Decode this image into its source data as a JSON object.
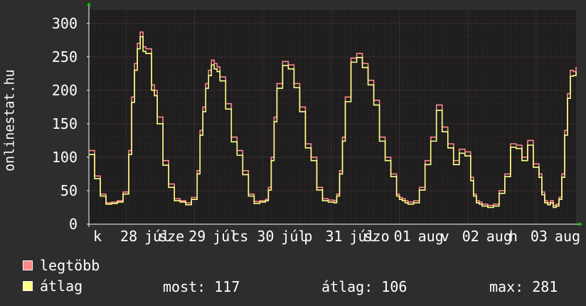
{
  "ylabel": "onlinestat.hu",
  "colors": {
    "background": "#2d2d2d",
    "plot_bg": "#1e1e1e",
    "grid_major": "#5a3a3a",
    "grid_minor": "#3e2a2a",
    "axis": "#ffffff",
    "tick_label": "#ffffff",
    "arrow": "#00cc00",
    "legtobb": "#ff8888",
    "atlag": "#ffff88"
  },
  "legend": [
    {
      "label": "legtöbb",
      "color": "#ff8888"
    },
    {
      "label": "átlag",
      "color": "#ffff88"
    }
  ],
  "stats": {
    "most": "most: 117",
    "atlag": "átlag: 106",
    "max": "max: 281"
  },
  "chart_data": {
    "type": "line",
    "ylabel": "onlinestat.hu",
    "ylim": [
      0,
      320
    ],
    "yticks": [
      0,
      50,
      100,
      150,
      200,
      250,
      300
    ],
    "xlim": [
      0,
      171
    ],
    "xtick_labels": [
      {
        "x": 3,
        "label": "k"
      },
      {
        "x": 14,
        "label": "28"
      },
      {
        "x": 24,
        "label": "júl"
      },
      {
        "x": 29,
        "label": "sze"
      },
      {
        "x": 38,
        "label": "29"
      },
      {
        "x": 48,
        "label": "júl"
      },
      {
        "x": 53,
        "label": "cs"
      },
      {
        "x": 62,
        "label": "30"
      },
      {
        "x": 72,
        "label": "júl"
      },
      {
        "x": 77,
        "label": "p"
      },
      {
        "x": 86,
        "label": "31"
      },
      {
        "x": 96,
        "label": "júl"
      },
      {
        "x": 101,
        "label": "szo"
      },
      {
        "x": 110,
        "label": "01"
      },
      {
        "x": 120,
        "label": "aug"
      },
      {
        "x": 125,
        "label": "v"
      },
      {
        "x": 134,
        "label": "02"
      },
      {
        "x": 144,
        "label": "aug"
      },
      {
        "x": 149,
        "label": "h"
      },
      {
        "x": 158,
        "label": "03"
      },
      {
        "x": 168,
        "label": "aug"
      }
    ],
    "grid": true,
    "legend_position": "bottom-left",
    "series": [
      {
        "name": "legtöbb",
        "color": "#ff8888",
        "x": [
          0,
          2,
          4,
          6,
          8,
          10,
          12,
          14,
          15,
          16,
          17,
          18,
          19,
          20,
          22,
          23,
          24,
          26,
          28,
          30,
          32,
          34,
          36,
          38,
          39,
          40,
          41,
          42,
          43,
          44,
          45,
          46,
          48,
          50,
          52,
          54,
          56,
          58,
          60,
          62,
          63,
          64,
          65,
          66,
          68,
          70,
          72,
          74,
          76,
          78,
          80,
          82,
          84,
          86,
          87,
          88,
          89,
          90,
          92,
          94,
          96,
          98,
          100,
          102,
          104,
          106,
          108,
          109,
          110,
          111,
          112,
          114,
          116,
          118,
          120,
          122,
          124,
          126,
          128,
          130,
          132,
          134,
          135,
          136,
          137,
          138,
          140,
          142,
          144,
          146,
          148,
          150,
          152,
          154,
          156,
          158,
          159,
          160,
          161,
          162,
          163,
          164,
          165,
          166,
          167,
          168,
          169,
          170,
          171
        ],
        "values": [
          110,
          72,
          45,
          32,
          33,
          35,
          48,
          110,
          190,
          240,
          270,
          287,
          265,
          262,
          208,
          200,
          160,
          95,
          60,
          38,
          35,
          32,
          40,
          80,
          140,
          175,
          210,
          230,
          245,
          240,
          235,
          220,
          180,
          130,
          110,
          80,
          45,
          34,
          35,
          37,
          55,
          100,
          160,
          210,
          243,
          238,
          210,
          175,
          120,
          100,
          55,
          38,
          36,
          35,
          45,
          80,
          130,
          190,
          248,
          255,
          240,
          215,
          185,
          130,
          100,
          75,
          45,
          40,
          38,
          35,
          33,
          35,
          55,
          95,
          130,
          178,
          145,
          120,
          95,
          112,
          108,
          70,
          45,
          35,
          33,
          30,
          28,
          30,
          50,
          75,
          120,
          118,
          100,
          125,
          90,
          75,
          48,
          35,
          32,
          35,
          28,
          30,
          40,
          75,
          140,
          195,
          230,
          228,
          235
        ]
      },
      {
        "name": "átlag",
        "color": "#ffff88",
        "x": [
          0,
          2,
          4,
          6,
          8,
          10,
          12,
          14,
          15,
          16,
          17,
          18,
          19,
          20,
          22,
          23,
          24,
          26,
          28,
          30,
          32,
          34,
          36,
          38,
          39,
          40,
          41,
          42,
          43,
          44,
          45,
          46,
          48,
          50,
          52,
          54,
          56,
          58,
          60,
          62,
          63,
          64,
          65,
          66,
          68,
          70,
          72,
          74,
          76,
          78,
          80,
          82,
          84,
          86,
          87,
          88,
          89,
          90,
          92,
          94,
          96,
          98,
          100,
          102,
          104,
          106,
          108,
          109,
          110,
          111,
          112,
          114,
          116,
          118,
          120,
          122,
          124,
          126,
          128,
          130,
          132,
          134,
          135,
          136,
          137,
          138,
          140,
          142,
          144,
          146,
          148,
          150,
          152,
          154,
          156,
          158,
          159,
          160,
          161,
          162,
          163,
          164,
          165,
          166,
          167,
          168,
          169,
          170,
          171
        ],
        "values": [
          104,
          68,
          42,
          30,
          31,
          33,
          45,
          104,
          182,
          230,
          262,
          280,
          258,
          255,
          200,
          192,
          150,
          88,
          55,
          35,
          33,
          29,
          37,
          75,
          133,
          168,
          203,
          222,
          238,
          232,
          228,
          214,
          172,
          123,
          103,
          74,
          42,
          31,
          33,
          35,
          51,
          95,
          153,
          203,
          237,
          232,
          204,
          168,
          114,
          95,
          51,
          35,
          33,
          32,
          42,
          75,
          124,
          183,
          242,
          249,
          234,
          208,
          178,
          124,
          95,
          71,
          42,
          37,
          35,
          32,
          30,
          32,
          51,
          89,
          124,
          170,
          138,
          114,
          89,
          106,
          102,
          65,
          42,
          32,
          30,
          27,
          25,
          27,
          46,
          71,
          115,
          113,
          95,
          118,
          85,
          70,
          44,
          32,
          29,
          32,
          25,
          27,
          37,
          70,
          133,
          188,
          221,
          222,
          228
        ]
      }
    ]
  }
}
